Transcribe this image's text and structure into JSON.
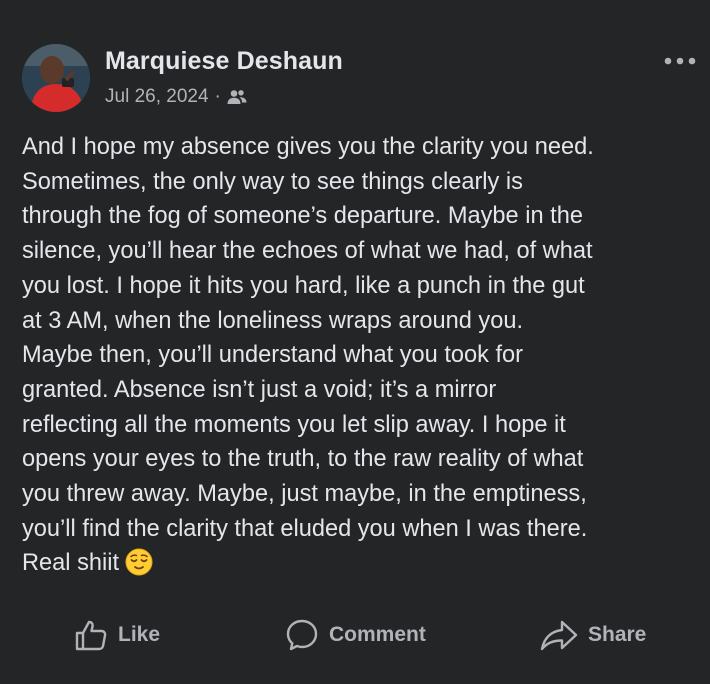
{
  "post": {
    "author_name": "Marquiese Deshaun",
    "date": "Jul 26, 2024",
    "separator": "·",
    "audience_icon": "friends-icon",
    "more_icon": "more-horizontal-icon",
    "body_lines": [
      "And I hope my absence gives you the clarity you need.",
      "Sometimes, the only way to see things clearly is",
      "through the fog of someone’s departure. Maybe in the",
      "silence, you’ll hear the echoes of what we had, of what",
      "you lost. I hope it hits you hard, like a punch in the gut",
      "at 3 AM, when the loneliness wraps around you.",
      "Maybe then, you’ll understand what you took for",
      "granted. Absence isn’t just a void; it’s a mirror",
      "reflecting all the moments you let slip away. I hope it",
      "opens your eyes to the truth, to the raw reality of what",
      "you threw away. Maybe, just maybe, in the emptiness,",
      "you’ll find the clarity that eluded you when I was there.",
      "Real shiit"
    ],
    "trailing_emoji": "relieved-face-emoji"
  },
  "actions": {
    "like_label": "Like",
    "comment_label": "Comment",
    "share_label": "Share"
  },
  "colors": {
    "background": "#242526",
    "primary_text": "#e4e6eb",
    "secondary_text": "#b0b3b8"
  }
}
